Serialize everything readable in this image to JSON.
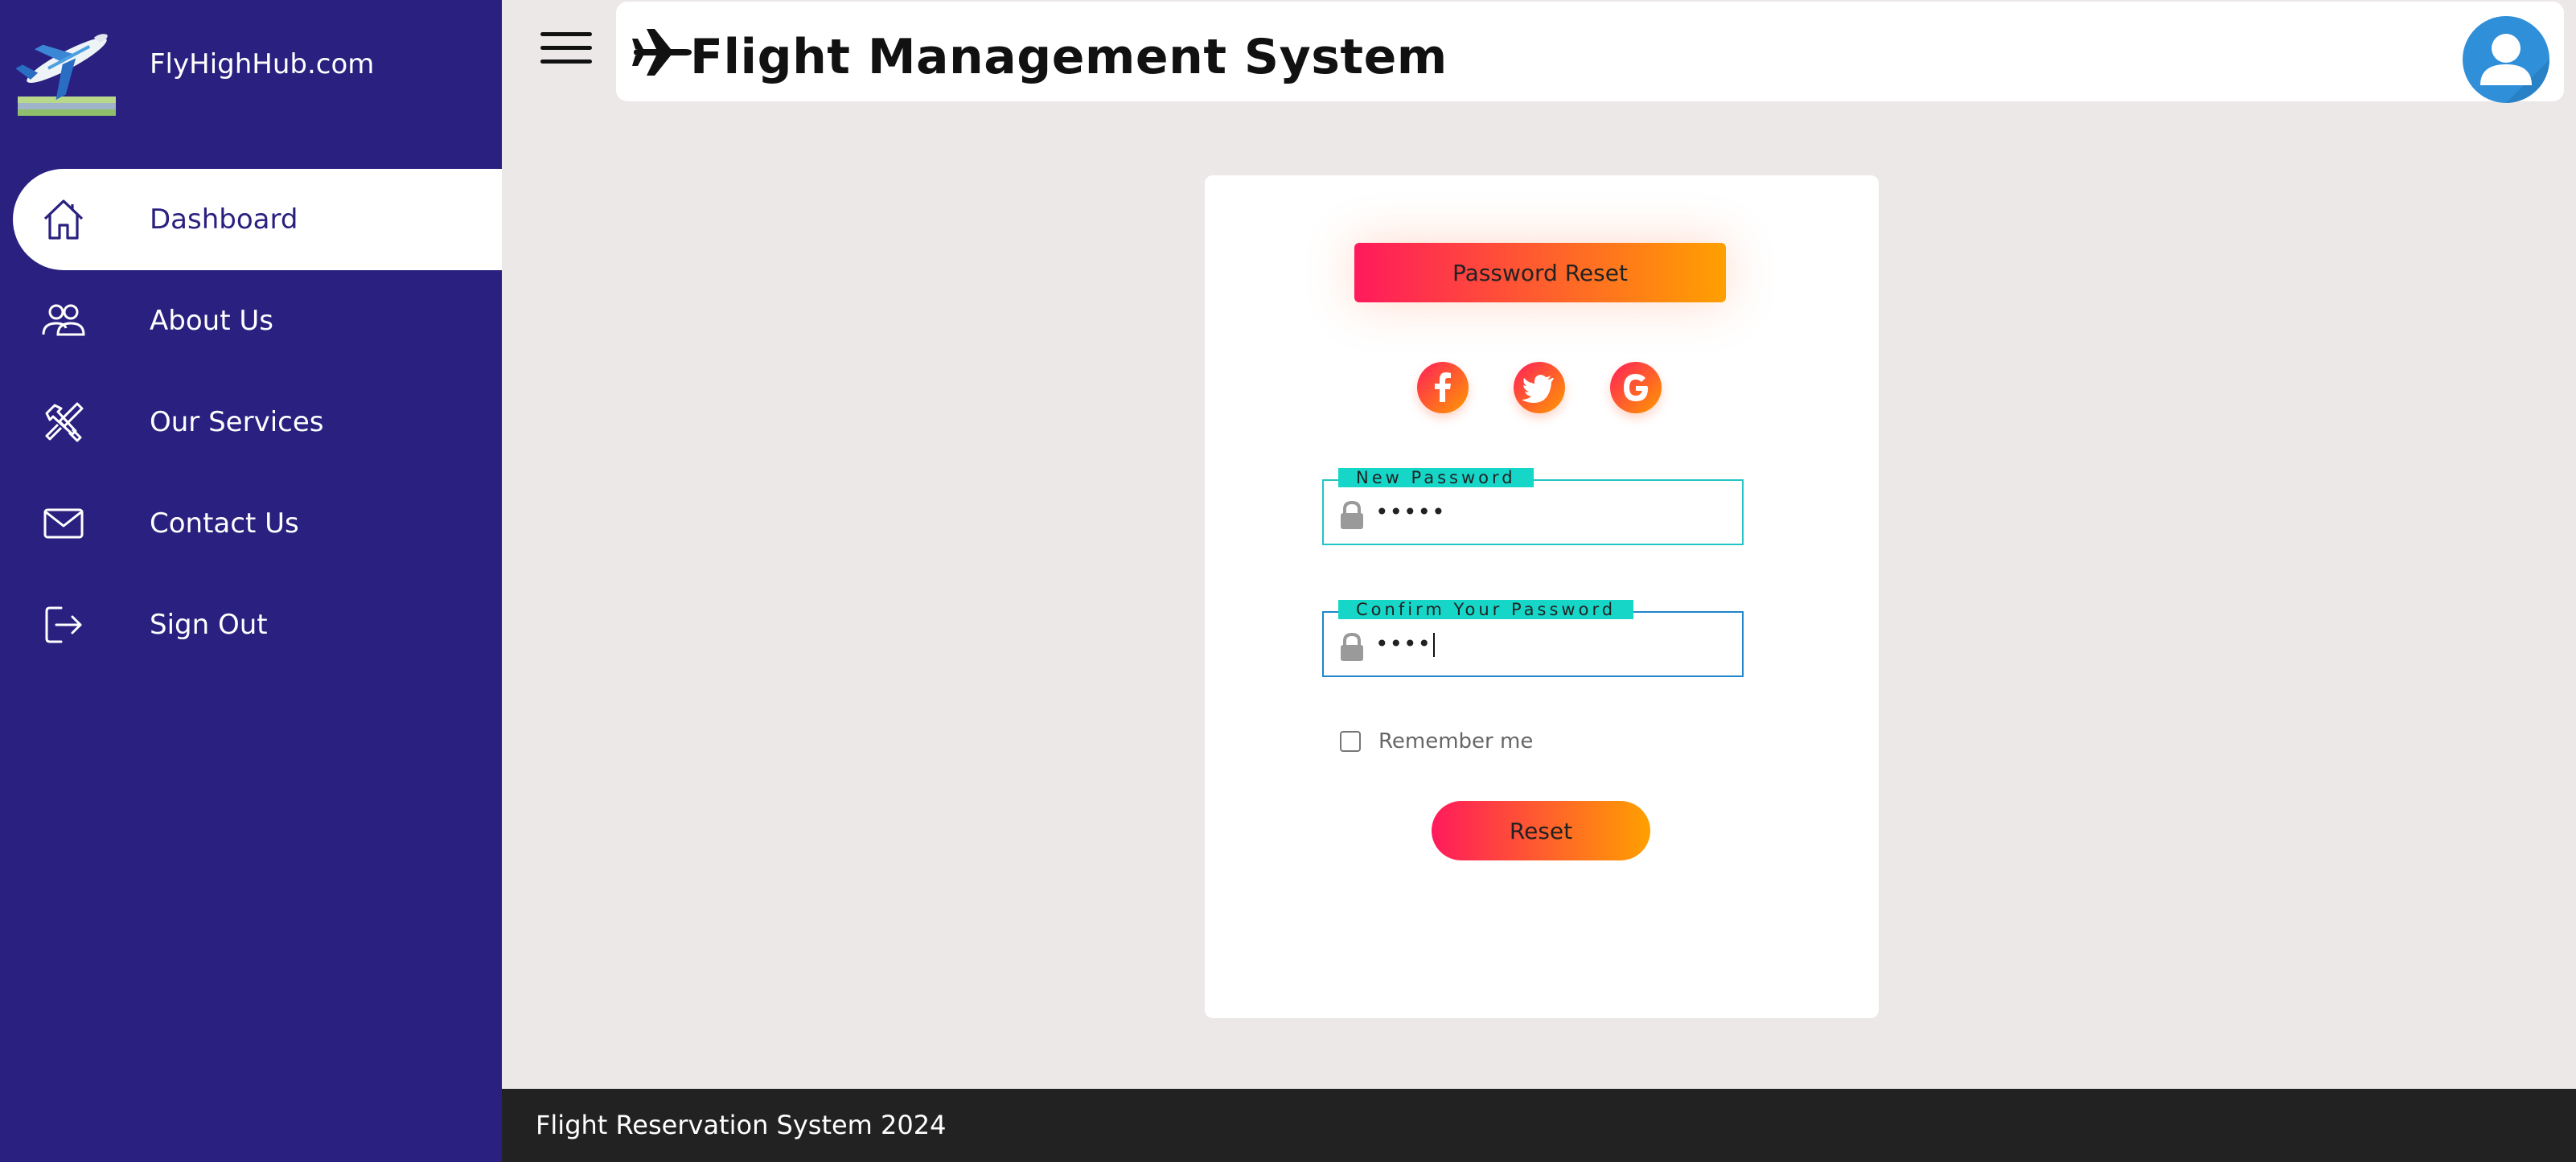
{
  "brand": {
    "name": "FlyHighHub.com",
    "logo_icon": "airplane-logo"
  },
  "sidebar": {
    "items": [
      {
        "label": "Dashboard",
        "icon": "home-icon",
        "active": true
      },
      {
        "label": "About Us",
        "icon": "users-icon",
        "active": false
      },
      {
        "label": "Our Services",
        "icon": "tools-icon",
        "active": false
      },
      {
        "label": "Contact Us",
        "icon": "mail-icon",
        "active": false
      },
      {
        "label": "Sign Out",
        "icon": "sign-out-icon",
        "active": false
      }
    ]
  },
  "header": {
    "title": "Flight Management System",
    "menu_icon": "hamburger-icon",
    "avatar_icon": "user-avatar-icon"
  },
  "form": {
    "title": "Password Reset",
    "socials": [
      {
        "name": "facebook",
        "glyph": "f"
      },
      {
        "name": "twitter",
        "glyph": "bird"
      },
      {
        "name": "google",
        "glyph": "G"
      }
    ],
    "new_password": {
      "legend": "New Password",
      "value": "•••••"
    },
    "confirm_password": {
      "legend": "Confirm Your Password",
      "value": "••••"
    },
    "remember_label": "Remember me",
    "remember_checked": false,
    "submit_label": "Reset"
  },
  "footer": {
    "text": "Flight Reservation System 2024"
  },
  "colors": {
    "sidebar_bg": "#29207f",
    "gradient_start": "#ff1a5c",
    "gradient_end": "#ffa000",
    "legend_bg": "#16d6c8",
    "footer_bg": "#222222",
    "page_bg": "#ece8e8"
  }
}
